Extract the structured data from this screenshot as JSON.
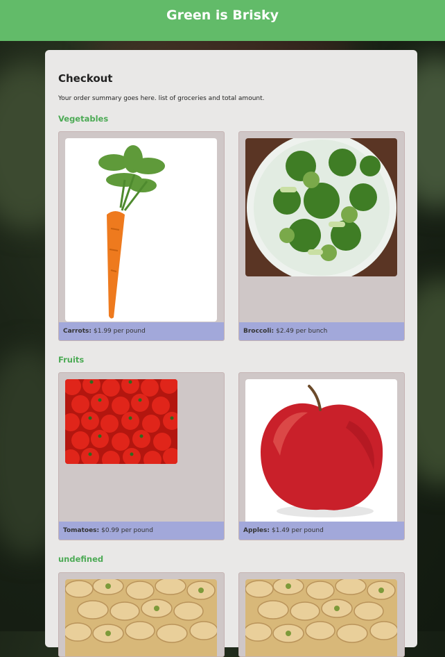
{
  "app": {
    "title": "Green is Brisky"
  },
  "checkout": {
    "heading": "Checkout",
    "summary": "Your order summary goes here. list of groceries and total amount."
  },
  "sections": [
    {
      "title": "Vegetables",
      "items": [
        {
          "name": "Carrots:",
          "price": "$1.99 per pound",
          "image": "carrot-photo"
        },
        {
          "name": "Broccoli:",
          "price": "$2.49 per bunch",
          "image": "broccoli-photo"
        }
      ]
    },
    {
      "title": "Fruits",
      "items": [
        {
          "name": "Tomatoes:",
          "price": "$0.99 per pound",
          "image": "tomatoes-photo"
        },
        {
          "name": "Apples:",
          "price": "$1.49 per pound",
          "image": "apple-photo"
        }
      ]
    },
    {
      "title": "undefined",
      "items": [
        {
          "image": "pistachios-photo"
        },
        {
          "image": "pistachios-photo"
        }
      ]
    }
  ],
  "colors": {
    "header": "#62bb69",
    "section_title": "#4caa55",
    "caption_bar": "#a2a8da",
    "item_bg": "#cfc7c7"
  }
}
